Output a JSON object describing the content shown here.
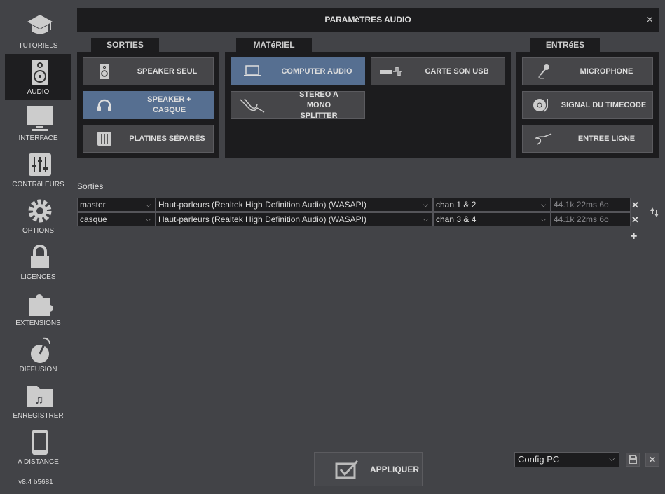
{
  "sidebar": {
    "items": [
      {
        "label": "TUTORIELS",
        "icon": "graduation-cap-icon"
      },
      {
        "label": "AUDIO",
        "icon": "speaker-icon",
        "selected": true
      },
      {
        "label": "INTERFACE",
        "icon": "monitor-icon"
      },
      {
        "label": "CONTRôLEURS",
        "icon": "mixer-icon"
      },
      {
        "label": "OPTIONS",
        "icon": "gear-icon"
      },
      {
        "label": "LICENCES",
        "icon": "lock-icon"
      },
      {
        "label": "EXTENSIONS",
        "icon": "puzzle-icon"
      },
      {
        "label": "DIFFUSION",
        "icon": "broadcast-icon"
      },
      {
        "label": "ENREGISTRER",
        "icon": "music-folder-icon"
      },
      {
        "label": "A DISTANCE",
        "icon": "phone-icon"
      }
    ],
    "version": "v8.4 b5681"
  },
  "title": "PARAMèTRES AUDIO",
  "close_icon": "×",
  "sections": {
    "sorties": {
      "tab": "SORTIES",
      "buttons": [
        "SPEAKER SEUL",
        "SPEAKER + CASQUE",
        "PLATINES SÉPARÉS"
      ]
    },
    "materiel": {
      "tab": "MATéRIEL",
      "buttons": [
        "COMPUTER AUDIO",
        "CARTE SON USB",
        "STEREO A MONO SPLITTER"
      ]
    },
    "entrees": {
      "tab": "ENTRéES",
      "buttons": [
        "MICROPHONE",
        "SIGNAL DU TIMECODE",
        "ENTREE LIGNE"
      ]
    }
  },
  "outputs": {
    "label": "Sorties",
    "rows": [
      {
        "name": "master",
        "device": "Haut-parleurs (Realtek High Definition Audio) (WASAPI)",
        "channels": "chan 1 & 2",
        "info": "44.1k 22ms 6o"
      },
      {
        "name": "casque",
        "device": "Haut-parleurs (Realtek High Definition Audio) (WASAPI)",
        "channels": "chan 3 & 4",
        "info": "44.1k 22ms 6o"
      }
    ],
    "remove": "✕",
    "add": "+"
  },
  "footer": {
    "apply": "APPLIQUER",
    "config": "Config PC",
    "close": "✕"
  },
  "colors": {
    "selected": "#566f91",
    "panel": "#1c1c1e",
    "background": "#424347"
  }
}
